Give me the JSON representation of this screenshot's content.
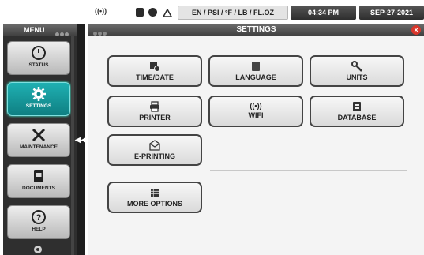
{
  "statusbar": {
    "wifi_label": "((•))",
    "units_label": "EN / PSI / °F / LB / FL.OZ",
    "time": "04:34 PM",
    "date": "SEP-27-2021"
  },
  "menu": {
    "title": "MENU",
    "collapse_glyph": "◀◀",
    "items": [
      {
        "label": "STATUS",
        "icon": "gauge-icon"
      },
      {
        "label": "SETTINGS",
        "icon": "gear-icon",
        "active": true
      },
      {
        "label": "MAINTENANCE",
        "icon": "tools-icon"
      },
      {
        "label": "DOCUMENTS",
        "icon": "document-icon"
      },
      {
        "label": "HELP",
        "icon": "help-icon"
      }
    ]
  },
  "settings": {
    "title": "SETTINGS",
    "close_glyph": "×",
    "buttons": [
      {
        "label": "TIME/DATE",
        "icon": "calendar-clock-icon"
      },
      {
        "label": "LANGUAGE",
        "icon": "language-icon"
      },
      {
        "label": "UNITS",
        "icon": "wrench-icon"
      },
      {
        "label": "PRINTER",
        "icon": "printer-icon"
      },
      {
        "label": "WIFI",
        "icon": "wifi-icon",
        "glyph": "((•))"
      },
      {
        "label": "DATABASE",
        "icon": "database-icon"
      },
      {
        "label": "E-PRINTING",
        "icon": "email-print-icon"
      },
      {
        "label": "MORE OPTIONS",
        "icon": "grid-icon"
      }
    ]
  }
}
